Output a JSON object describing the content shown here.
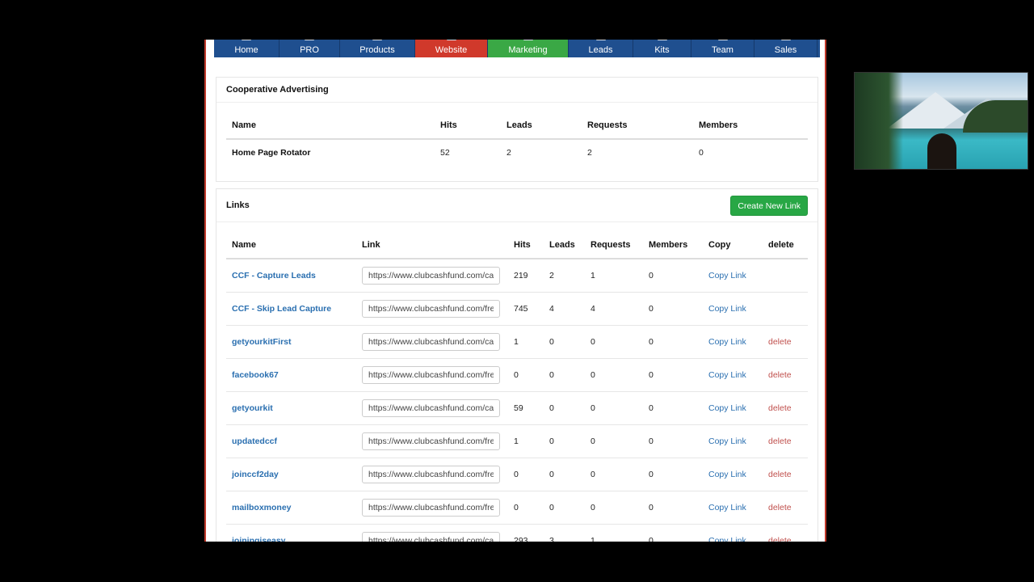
{
  "nav": {
    "items": [
      {
        "label": "Home",
        "style": "blue"
      },
      {
        "label": "PRO",
        "style": "blue"
      },
      {
        "label": "Products",
        "style": "blue"
      },
      {
        "label": "Website",
        "style": "red"
      },
      {
        "label": "Marketing",
        "style": "green"
      },
      {
        "label": "Leads",
        "style": "blue"
      },
      {
        "label": "Kits",
        "style": "blue"
      },
      {
        "label": "Team",
        "style": "blue"
      },
      {
        "label": "Sales",
        "style": "blue"
      }
    ]
  },
  "coop": {
    "title": "Cooperative Advertising",
    "headers": [
      "Name",
      "Hits",
      "Leads",
      "Requests",
      "Members"
    ],
    "rows": [
      {
        "name": "Home Page Rotator",
        "hits": "52",
        "leads": "2",
        "requests": "2",
        "members": "0"
      }
    ]
  },
  "links": {
    "title": "Links",
    "create_label": "Create New Link",
    "headers": [
      "Name",
      "Link",
      "Hits",
      "Leads",
      "Requests",
      "Members",
      "Copy",
      "delete"
    ],
    "copy_label": "Copy Link",
    "delete_label": "delete",
    "rows": [
      {
        "name": "CCF - Capture Leads",
        "link": "https://www.clubcashfund.com/cale",
        "hits": "219",
        "leads": "2",
        "requests": "1",
        "members": "0",
        "deletable": false
      },
      {
        "name": "CCF - Skip Lead Capture",
        "link": "https://www.clubcashfund.com/free",
        "hits": "745",
        "leads": "4",
        "requests": "4",
        "members": "0",
        "deletable": false
      },
      {
        "name": "getyourkitFirst",
        "link": "https://www.clubcashfund.com/cale",
        "hits": "1",
        "leads": "0",
        "requests": "0",
        "members": "0",
        "deletable": true
      },
      {
        "name": "facebook67",
        "link": "https://www.clubcashfund.com/free",
        "hits": "0",
        "leads": "0",
        "requests": "0",
        "members": "0",
        "deletable": true
      },
      {
        "name": "getyourkit",
        "link": "https://www.clubcashfund.com/cale",
        "hits": "59",
        "leads": "0",
        "requests": "0",
        "members": "0",
        "deletable": true
      },
      {
        "name": "updatedccf",
        "link": "https://www.clubcashfund.com/free",
        "hits": "1",
        "leads": "0",
        "requests": "0",
        "members": "0",
        "deletable": true
      },
      {
        "name": "joinccf2day",
        "link": "https://www.clubcashfund.com/free",
        "hits": "0",
        "leads": "0",
        "requests": "0",
        "members": "0",
        "deletable": true
      },
      {
        "name": "mailboxmoney",
        "link": "https://www.clubcashfund.com/free",
        "hits": "0",
        "leads": "0",
        "requests": "0",
        "members": "0",
        "deletable": true
      },
      {
        "name": "joiningiseasy",
        "link": "https://www.clubcashfund.com/cale",
        "hits": "293",
        "leads": "3",
        "requests": "1",
        "members": "0",
        "deletable": true
      }
    ]
  },
  "colors": {
    "nav_blue": "#1f4f8f",
    "nav_red": "#d0392b",
    "nav_green": "#3aa845",
    "link_blue": "#2a6fb0",
    "delete_red": "#c0504d",
    "button_green": "#28a745"
  }
}
